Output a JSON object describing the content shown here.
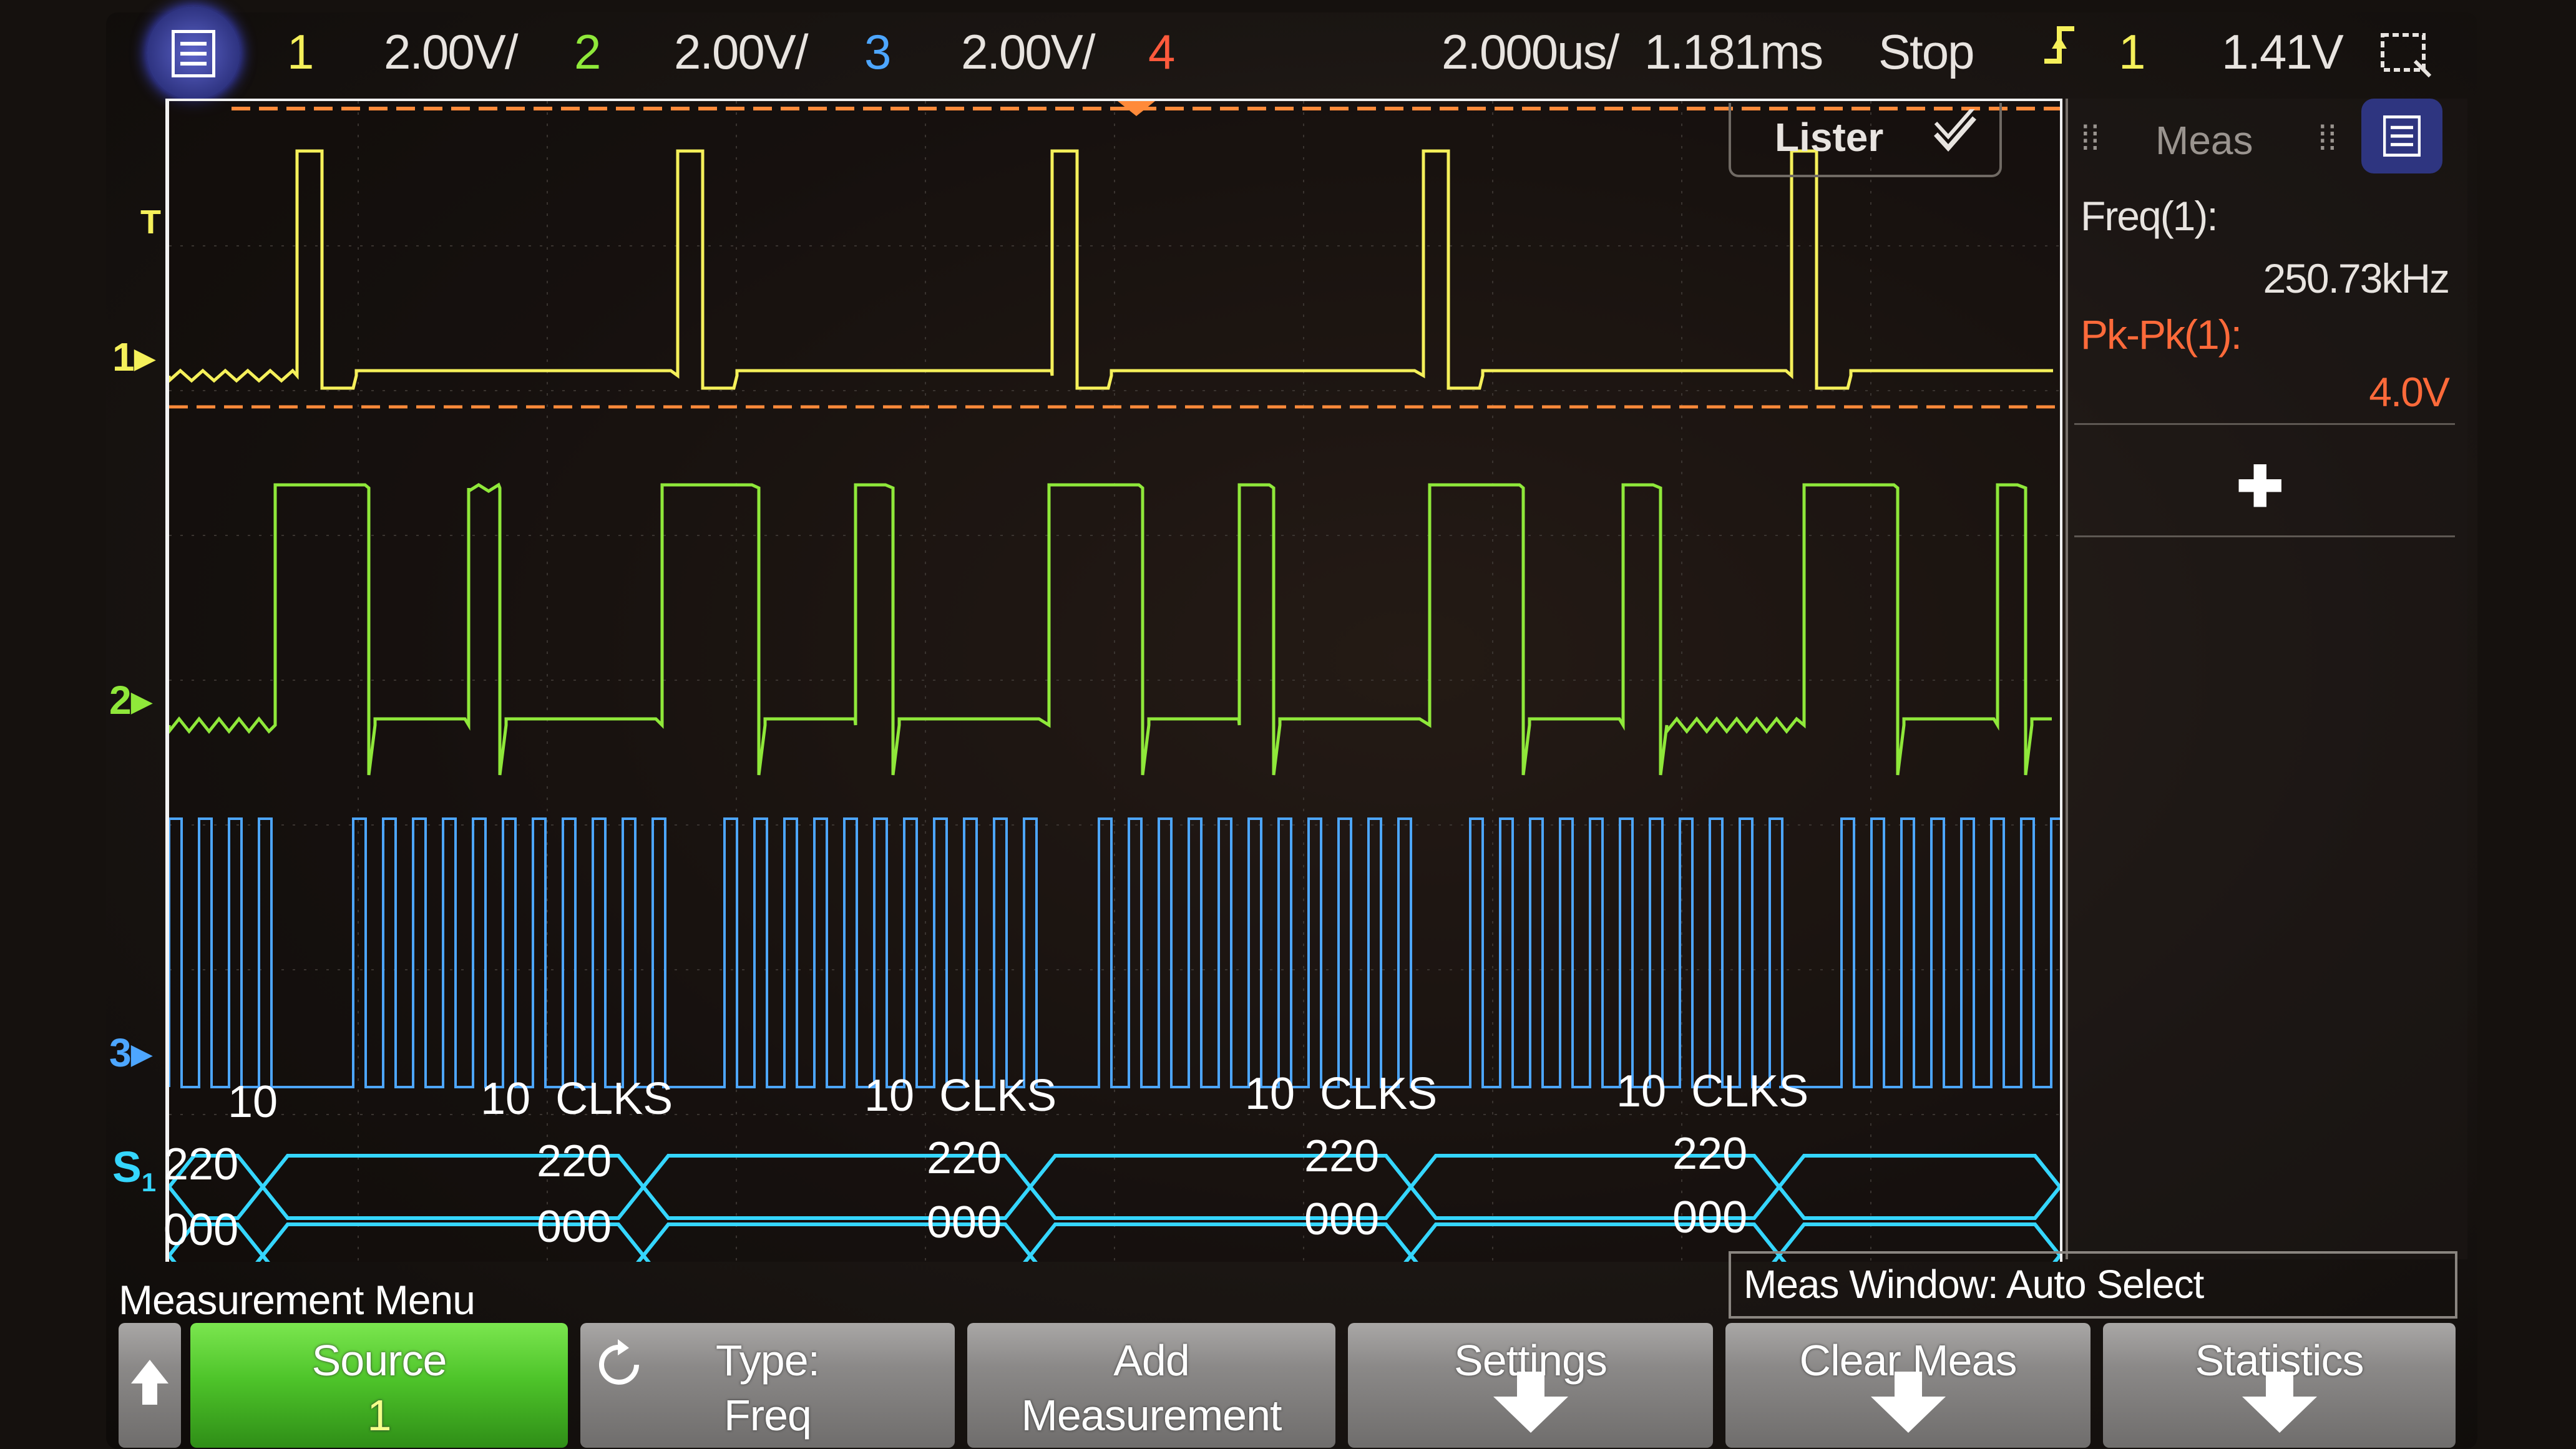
{
  "colors": {
    "ch1": "#f5f05a",
    "ch2": "#8fe83a",
    "ch3": "#4da6ff",
    "ch4": "#ff5a3c",
    "bus": "#35d6ff",
    "trigger_orange": "#ff8a3a",
    "meas_red": "#ff6a3a"
  },
  "status_bar": {
    "ch1_label": "1",
    "ch1_scale": "2.00V/",
    "ch2_label": "2",
    "ch2_scale": "2.00V/",
    "ch3_label": "3",
    "ch3_scale": "2.00V/",
    "ch4_label": "4",
    "timebase": "2.000us/",
    "delay": "1.181ms",
    "run_state": "Stop",
    "trigger_icon": "trigger-edge-icon",
    "trigger_source": "1",
    "trigger_level": "1.41V"
  },
  "waveform": {
    "ch1_marker": "1",
    "ch2_marker": "2",
    "ch3_marker": "3",
    "trigger_marker": "T",
    "bus_label": "S",
    "bus_index": "1",
    "lister_label": "Lister",
    "clk_labels": [
      "10",
      "10  CLKS",
      "10  CLKS",
      "10  CLKS",
      "10  CLKS"
    ],
    "bus_values_top": [
      "220",
      "220",
      "220",
      "220",
      "220"
    ],
    "bus_values_bottom": [
      "000",
      "000",
      "000",
      "000",
      "000"
    ]
  },
  "meas_panel": {
    "title": "Meas",
    "measurements": [
      {
        "label": "Freq(1):",
        "value": "250.73kHz"
      },
      {
        "label": "Pk-Pk(1):",
        "value": "4.0V"
      }
    ],
    "add_icon": "plus-icon"
  },
  "menu": {
    "title": "Measurement Menu",
    "meas_window": "Meas Window: Auto Select",
    "softkeys": [
      {
        "line1": "Source",
        "line2": "1"
      },
      {
        "line1": "Type:",
        "line2": "Freq"
      },
      {
        "line1": "Add",
        "line2": "Measurement"
      },
      {
        "line1": "Settings",
        "line2": ""
      },
      {
        "line1": "Clear Meas",
        "line2": ""
      },
      {
        "line1": "Statistics",
        "line2": ""
      }
    ]
  }
}
